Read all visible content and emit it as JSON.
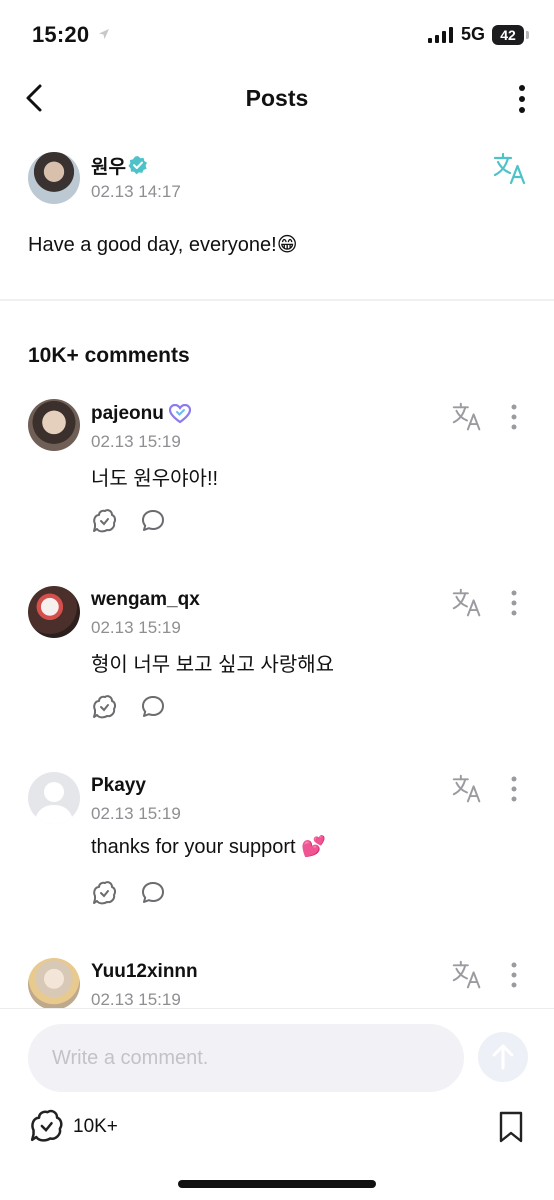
{
  "status_bar": {
    "time": "15:20",
    "network": "5G",
    "battery": "42"
  },
  "header": {
    "title": "Posts"
  },
  "post": {
    "author": "원우",
    "date": "02.13 14:17",
    "body": "Have a good day, everyone!",
    "body_emoji": "😁"
  },
  "comments_section": {
    "count_label": "10K+ comments"
  },
  "comments": [
    {
      "user": "pajeonu",
      "date": "02.13 15:19",
      "text": "너도 원우야아!!",
      "emoji": ""
    },
    {
      "user": "wengam_qx",
      "date": "02.13 15:19",
      "text": "형이 너무 보고 싶고 사랑해요",
      "emoji": ""
    },
    {
      "user": "Pkayy",
      "date": "02.13 15:19",
      "text": "thanks for your support ",
      "emoji": "💕"
    },
    {
      "user": "Yuu12xinnn",
      "date": "02.13 15:19",
      "text": "",
      "emoji": ""
    }
  ],
  "composer": {
    "placeholder": "Write a comment."
  },
  "footer": {
    "like_count": "10K+"
  },
  "colors": {
    "accent": "#4ec2c9",
    "muted": "#8e8e93",
    "icon": "#9a9aa0"
  }
}
